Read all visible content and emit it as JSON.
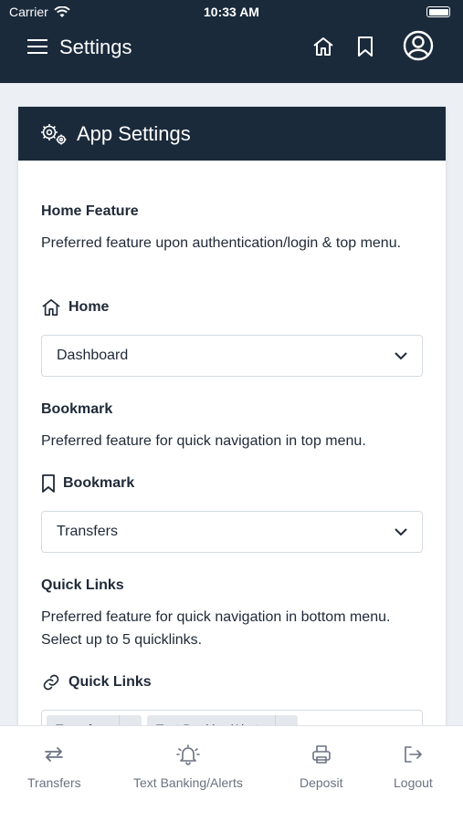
{
  "status_bar": {
    "carrier": "Carrier",
    "time": "10:33 AM"
  },
  "header": {
    "title": "Settings",
    "icons": [
      "menu-icon",
      "home-icon",
      "bookmark-icon",
      "profile-icon"
    ]
  },
  "card": {
    "title": "App Settings",
    "home_feature": {
      "heading": "Home Feature",
      "description": "Preferred feature upon authentication/login & top menu.",
      "label": "Home",
      "value": "Dashboard"
    },
    "bookmark": {
      "heading": "Bookmark",
      "description": "Preferred feature for quick navigation in top menu.",
      "label": "Bookmark",
      "value": "Transfers"
    },
    "quick_links": {
      "heading": "Quick Links",
      "description": "Preferred feature for quick navigation in bottom menu. Select up to 5 quicklinks.",
      "label": "Quick Links",
      "chips": [
        "Transfers",
        "Text Banking/Alerts"
      ]
    }
  },
  "bottom_nav": {
    "items": [
      {
        "label": "Transfers",
        "icon": "transfers-icon"
      },
      {
        "label": "Text Banking/Alerts",
        "icon": "bell-icon"
      },
      {
        "label": "Deposit",
        "icon": "printer-icon"
      },
      {
        "label": "Logout",
        "icon": "logout-icon"
      }
    ]
  },
  "colors": {
    "header_bg": "#1b2a3b",
    "page_bg": "#ecf0f4",
    "accent_text": "#1f2937"
  }
}
